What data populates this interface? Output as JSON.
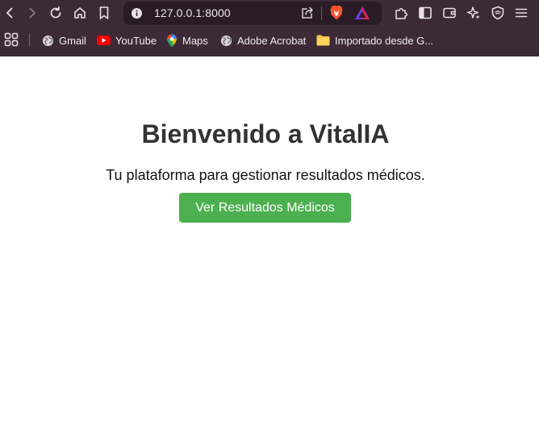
{
  "browser": {
    "address_bar": {
      "url": "127.0.0.1:8000"
    },
    "bookmarks": [
      {
        "label": "Gmail",
        "icon": "globe-icon"
      },
      {
        "label": "YouTube",
        "icon": "youtube-icon"
      },
      {
        "label": "Maps",
        "icon": "maps-pin-icon"
      },
      {
        "label": "Adobe Acrobat",
        "icon": "globe-icon"
      },
      {
        "label": "Importado desde G...",
        "icon": "folder-icon"
      }
    ],
    "colors": {
      "chrome": "#3d2a37",
      "urlbar": "#2a1c26",
      "brave": "#fb542b"
    }
  },
  "page": {
    "title": "Bienvenido a VitalIA",
    "subtitle": "Tu plataforma para gestionar resultados médicos.",
    "cta_label": "Ver Resultados Médicos",
    "colors": {
      "cta_bg": "#4caf50",
      "title": "#333333"
    }
  }
}
